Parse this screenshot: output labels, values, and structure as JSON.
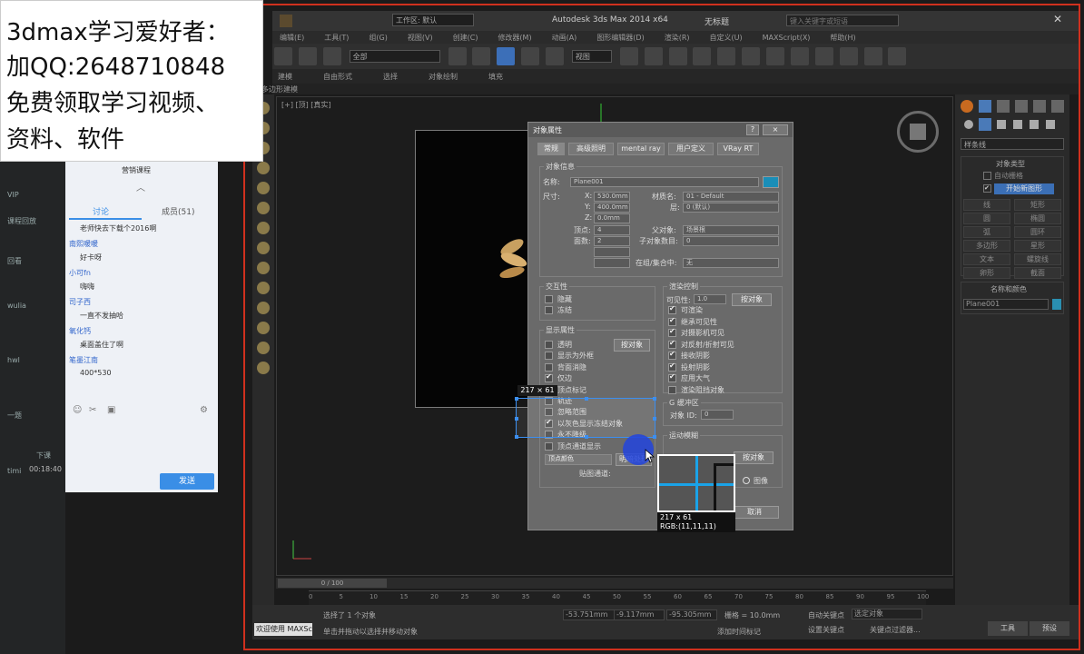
{
  "promo": {
    "line1": "3dmax学习爱好者：",
    "line2": "加QQ:2648710848",
    "line3": "免费领取学习视频、",
    "line4": "资料、软件"
  },
  "max": {
    "app_title": "Autodesk 3ds Max  2014 x64",
    "doc_title": "无标题",
    "workspace": "工作区: 默认",
    "search_placeholder": "键入关键字或短语",
    "menus": [
      "编辑(E)",
      "工具(T)",
      "组(G)",
      "视图(V)",
      "创建(C)",
      "修改器(M)",
      "动画(A)",
      "图形编辑器(D)",
      "渲染(R)",
      "自定义(U)",
      "MAXScript(X)",
      "帮助(H)"
    ],
    "ribbon_tabs": [
      "建模",
      "自由形式",
      "选择",
      "对象绘制",
      "填充"
    ],
    "sub_label": "多边形建模",
    "filter_all": "全部",
    "view_drop": "视图",
    "viewport_label": "[+] [顶] [真实]",
    "timeline": "0 / 100",
    "ruler_ticks": [
      "0",
      "5",
      "10",
      "15",
      "20",
      "25",
      "30",
      "35",
      "40",
      "45",
      "50",
      "55",
      "60",
      "65",
      "70",
      "75",
      "80",
      "85",
      "90",
      "95",
      "100"
    ]
  },
  "cmd_panel": {
    "category": "样条线",
    "object_type": "对象类型",
    "auto_grid": "自动栅格",
    "start_new_shape": "开始新图形",
    "shapes": [
      "线",
      "矩形",
      "圆",
      "椭圆",
      "弧",
      "圆环",
      "多边形",
      "星形",
      "文本",
      "螺旋线",
      "卵形",
      "截面"
    ],
    "name_color": "名称和颜色",
    "object_name": "Plane001"
  },
  "status": {
    "selected": "选择了 1 个对象",
    "hint": "单击并拖动以选择并移动对象",
    "welcome": "欢迎使用 MAXSc",
    "x": "-53.751mm",
    "y": "-9.117mm",
    "z": "-95.305mm",
    "grid": "栅格 = 10.0mm",
    "auto_key": "自动关键点",
    "set_key": "设置关键点",
    "sel_obj": "选定对象",
    "key_filter": "关键点过滤器...",
    "add_time_tag": "添加时间标记",
    "tools": "工具",
    "preset": "预设"
  },
  "dialog": {
    "title": "对象属性",
    "help": "?",
    "close": "×",
    "tabs": [
      "常规",
      "高级照明",
      "mental ray",
      "用户定义",
      "VRay RT"
    ],
    "info_group": "对象信息",
    "name_label": "名称:",
    "name_value": "Plane001",
    "dims_label": "尺寸:",
    "x_label": "X:",
    "x_value": "530.0mm",
    "y_label": "Y:",
    "y_value": "400.0mm",
    "z_label": "Z:",
    "z_value": "0.0mm",
    "material_label": "材质名:",
    "material_value": "01 - Default",
    "layer_label": "层:",
    "layer_value": "0 (默认)",
    "verts_label": "顶点:",
    "verts_value": "4",
    "faces_label": "面数:",
    "faces_value": "2",
    "parent_label": "父对象:",
    "parent_value": "场景根",
    "children_label": "子对象数目:",
    "children_value": "0",
    "group_label": "在组/集合中:",
    "group_value": "无",
    "interactivity": "交互性",
    "hide": "隐藏",
    "freeze": "冻结",
    "display_props": "显示属性",
    "by_object_btn": "按对象",
    "display_items": [
      "透明",
      "显示为外框",
      "背面消隐",
      "仅边",
      "顶点标记",
      "轨迹",
      "忽略范围",
      "以灰色显示冻结对象",
      "永不降级",
      "顶点通道显示"
    ],
    "vertex_color": "顶点颜色",
    "shaded": "明暗处理",
    "map_channel": "贴图通道:",
    "render_control": "渲染控制",
    "visibility_label": "可见性:",
    "visibility_value": "1.0",
    "render_items": [
      "可渲染",
      "继承可见性",
      "对摄影机可见",
      "对反射/折射可见",
      "接收阴影",
      "投射阴影",
      "应用大气",
      "渲染阻挡对象"
    ],
    "gbuffer": "G 缓冲区",
    "object_id_label": "对象 ID:",
    "object_id_value": "0",
    "motion_blur": "运动模糊",
    "image": "图像",
    "ok": "确定",
    "cancel": "取消"
  },
  "selection": {
    "size": "217 × 61",
    "readout_size": "217 x 61",
    "readout_rgb": "RGB:(11,11,11)"
  },
  "chat": {
    "marketing": "营销课程",
    "tab_discuss": "讨论",
    "tab_members": "成员(51)",
    "messages": [
      {
        "name": "",
        "text": "老师快去下载个2016啊"
      },
      {
        "name": "南熙暖暖",
        "text": "好卡呀"
      },
      {
        "name": "小可fn",
        "text": "嗨嗨"
      },
      {
        "name": "司子西",
        "text": "一直不发抽哈"
      },
      {
        "name": "氧化钙",
        "text": "桌面盖住了啊"
      },
      {
        "name": "笔墨江南",
        "text": "400*530"
      }
    ],
    "send": "发送",
    "side_labels": [
      "VIP",
      "课程回放",
      "回看",
      "wulia",
      "hwl",
      "一题",
      "下课",
      "timi"
    ],
    "time": "00:18:40"
  },
  "colors": {
    "accent": "#3c8ff0",
    "recording_frame": "#d0301e",
    "send_button": "#3a8ee6"
  }
}
